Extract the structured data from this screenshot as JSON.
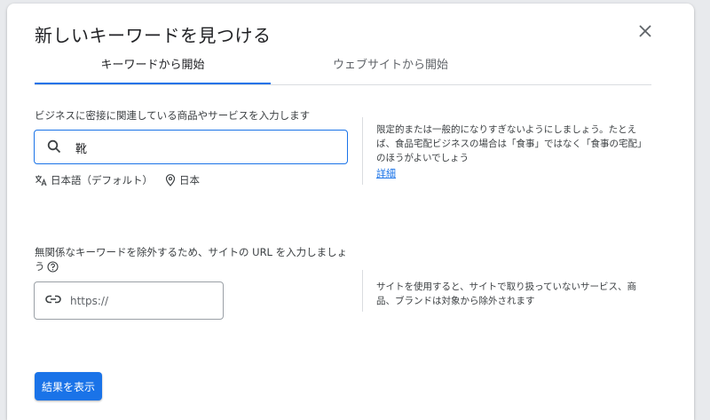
{
  "dialog": {
    "title": "新しいキーワードを見つける"
  },
  "tabs": [
    {
      "label": "キーワードから開始",
      "active": true
    },
    {
      "label": "ウェブサイトから開始",
      "active": false
    }
  ],
  "keyword_section": {
    "label": "ビジネスに密接に関連している商品やサービスを入力します",
    "input_value": "靴",
    "language": "日本語（デフォルト）",
    "location": "日本",
    "hint": "限定的または一般的になりすぎないようにしましょう。たとえば、食品宅配ビジネスの場合は「食事」ではなく「食事の宅配」のほうがよいでしょう",
    "details_link": "詳細"
  },
  "url_section": {
    "label": "無関係なキーワードを除外するため、サイトの URL を入力しましょう",
    "placeholder": "https://",
    "hint": "サイトを使用すると、サイトで取り扱っていないサービス、商品、ブランドは対象から除外されます"
  },
  "submit_label": "結果を表示",
  "colors": {
    "accent": "#1a73e8",
    "text": "#3c4043",
    "divider": "#dadce0"
  },
  "icons": {
    "close": "close-icon",
    "search": "search-icon",
    "translate": "translate-icon",
    "location": "location-pin-icon",
    "help": "help-icon",
    "link": "link-icon"
  }
}
